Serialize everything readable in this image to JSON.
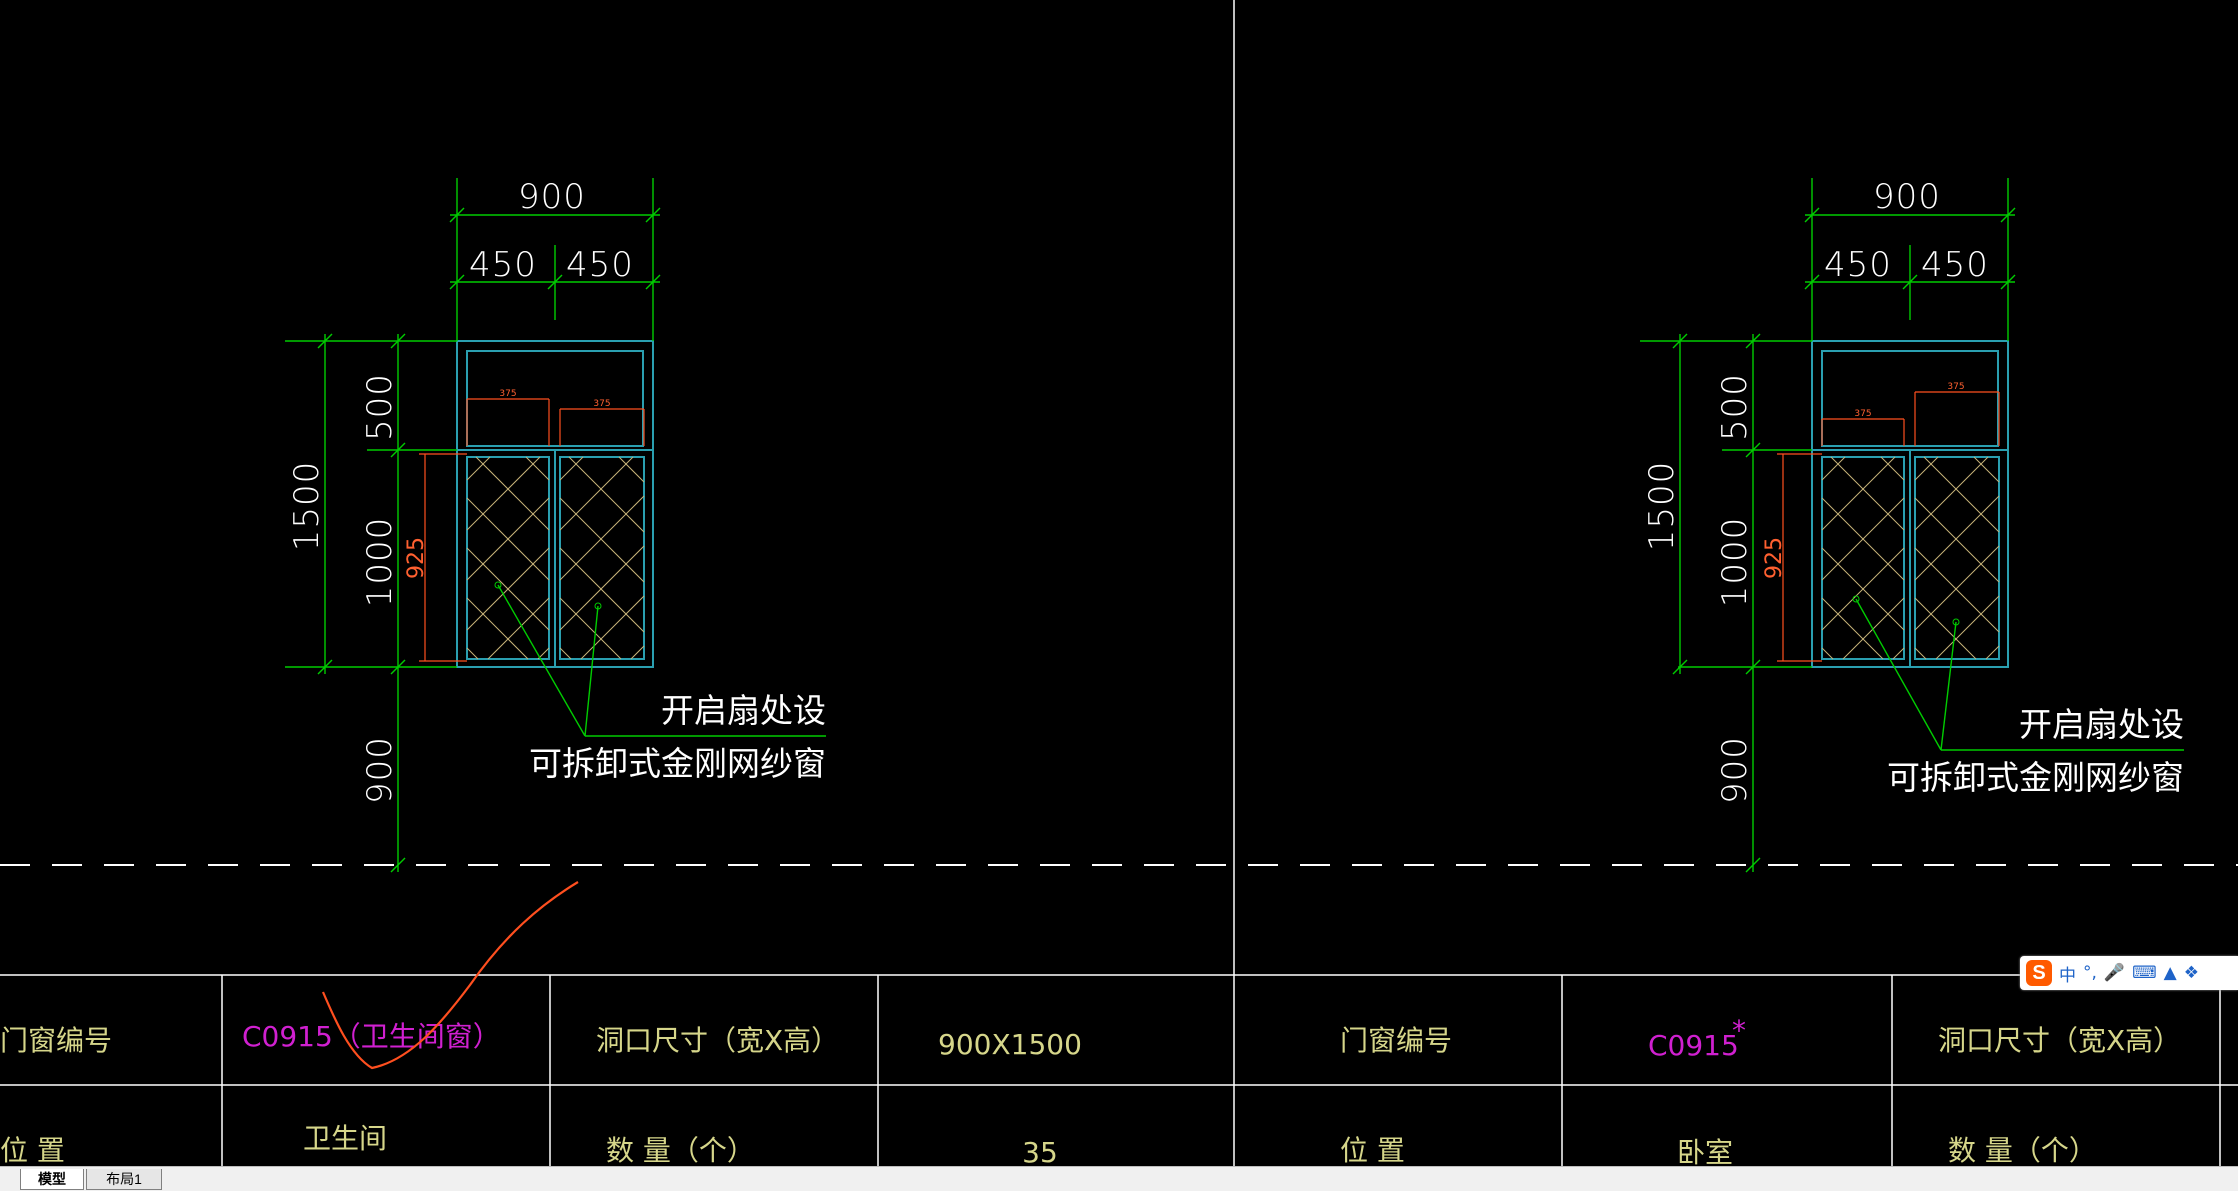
{
  "drawing": {
    "left": {
      "dims": {
        "total_width": "900",
        "half_a": "450",
        "half_b": "450",
        "total_height": "1500",
        "top_panel": "500",
        "lower_panel": "1000",
        "sill": "900",
        "sash_height": "925",
        "sash_w_a": "375",
        "sash_w_b": "375"
      },
      "note_line1": "开启扇处设",
      "note_line2": "可拆卸式金刚网纱窗"
    },
    "right": {
      "dims": {
        "total_width": "900",
        "half_a": "450",
        "half_b": "450",
        "total_height": "1500",
        "top_panel": "500",
        "lower_panel": "1000",
        "sill": "900",
        "sash_height": "925",
        "sash_w_a": "375",
        "sash_w_b": "375"
      },
      "note_line1": "开启扇处设",
      "note_line2": "可拆卸式金刚网纱窗"
    }
  },
  "table": {
    "left": {
      "label_code": "门窗编号",
      "code": "C0915（卫生间窗）",
      "label_size": "洞口尺寸（宽X高）",
      "size": "900X1500",
      "label_location": "位    置",
      "location": "卫生间",
      "label_qty": "数      量（个）",
      "qty": "35"
    },
    "right": {
      "label_code": "门窗编号",
      "code": "C0915",
      "label_size": "洞口尺寸（宽X高）",
      "label_location": "位    置",
      "location": "卧室",
      "label_qty": "数      量（个）"
    }
  },
  "tabs": [
    {
      "label": "模型",
      "active": true
    },
    {
      "label": "布局1",
      "active": false
    }
  ],
  "ime_toolbar": {
    "logo": "S",
    "items": [
      "中",
      "°,",
      "mic-icon",
      "keyboard-icon",
      "shirt-icon",
      "grid-icon"
    ],
    "lang": "中",
    "punct": "°,"
  },
  "colors": {
    "dimension": "#00cc00",
    "frame": "#2a9fb0",
    "mesh": "#c8b47a",
    "accent_red": "#ff4f1f",
    "magenta": "#d020d0",
    "grid": "#ffffff"
  }
}
